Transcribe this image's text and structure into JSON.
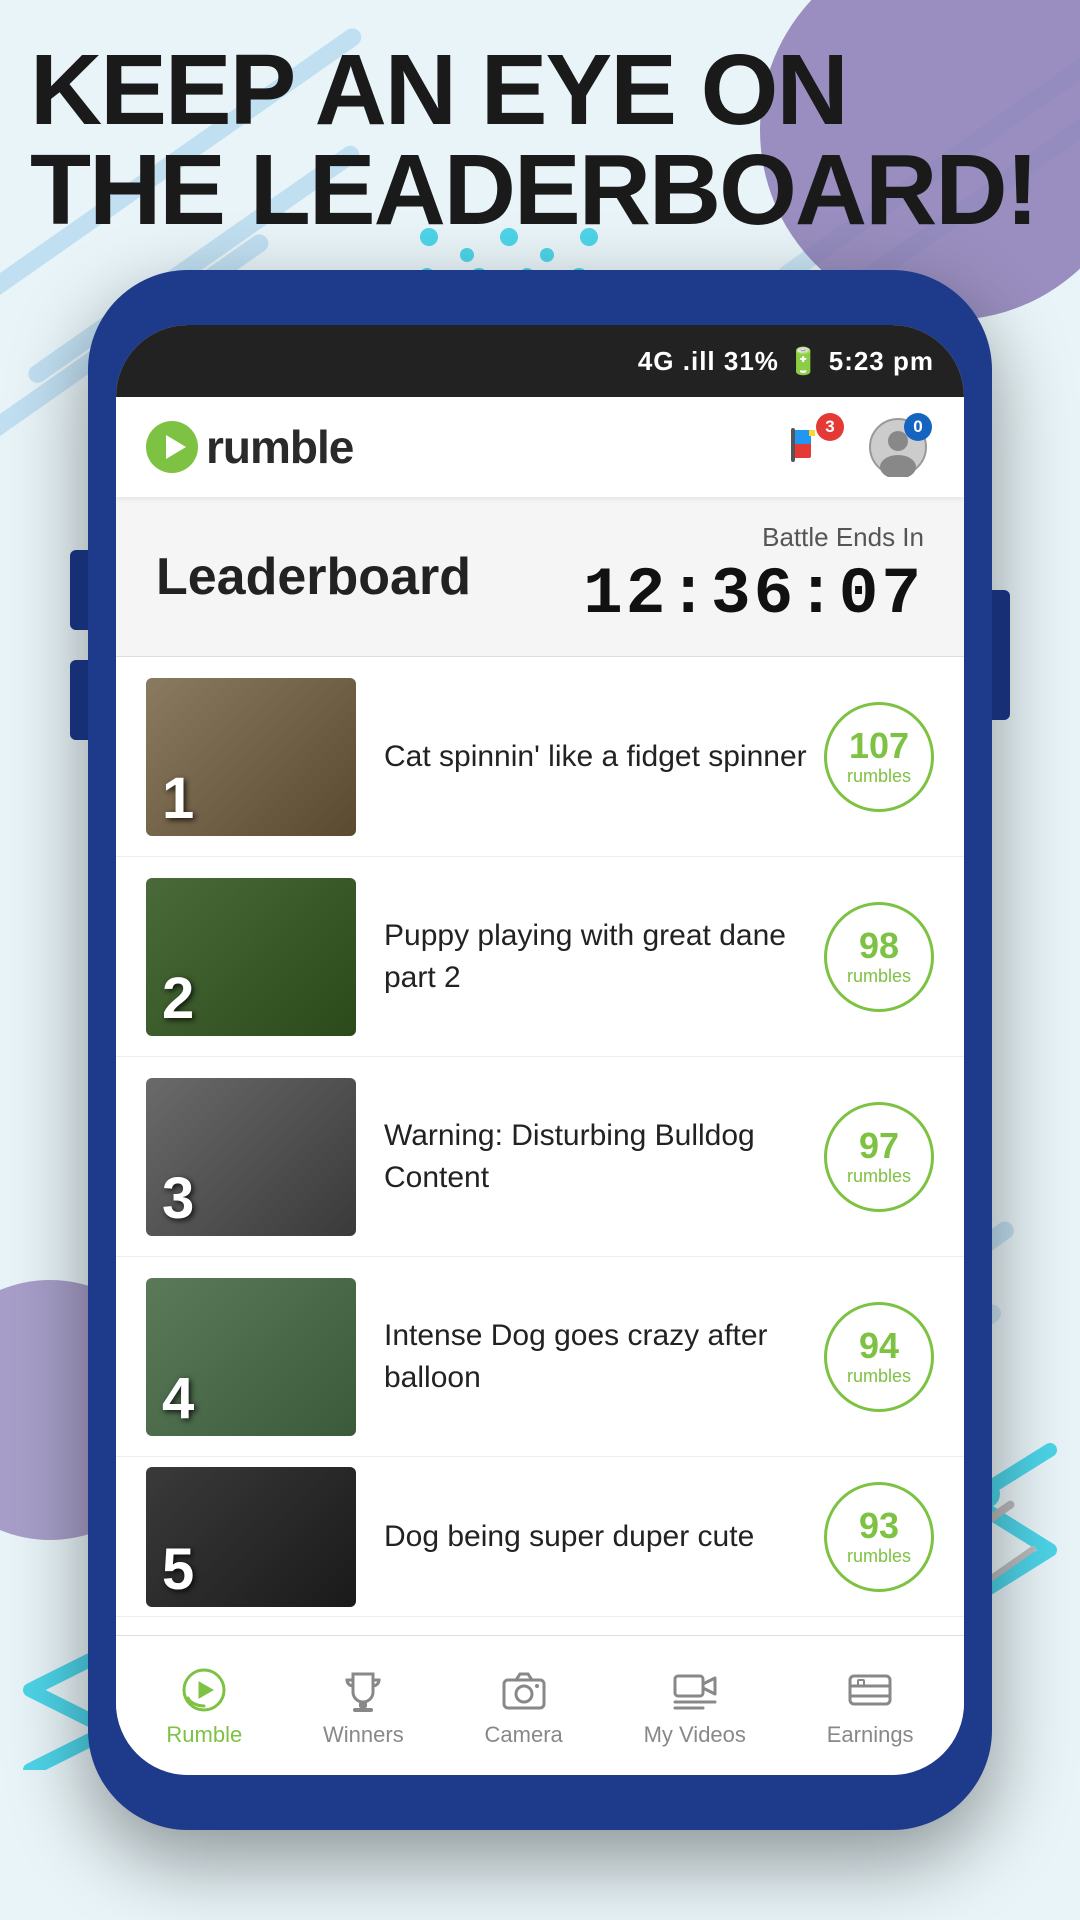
{
  "background": {
    "headline_line1": "KEEP AN EYE ON",
    "headline_line2": "THE LEADERBOARD!"
  },
  "status_bar": {
    "signal": "4G",
    "bars": "▌▌▌",
    "battery": "31%",
    "time": "5:23 pm",
    "full": "4G  .ill  31%  🔋  5:23 pm"
  },
  "app_header": {
    "logo_text": "rumble",
    "notification_badge": "3",
    "profile_badge": "0"
  },
  "leaderboard": {
    "title": "Leaderboard",
    "battle_ends_label": "Battle Ends In",
    "timer": "12:36:07"
  },
  "videos": [
    {
      "rank": "1",
      "title": "Cat spinnin' like a fidget spinner",
      "rumbles": "107",
      "rumbles_label": "rumbles",
      "thumb_class": "thumb-bg-1"
    },
    {
      "rank": "2",
      "title": "Puppy playing with great dane part 2",
      "rumbles": "98",
      "rumbles_label": "rumbles",
      "thumb_class": "thumb-bg-2"
    },
    {
      "rank": "3",
      "title": "Warning: Disturbing Bulldog Content",
      "rumbles": "97",
      "rumbles_label": "rumbles",
      "thumb_class": "thumb-bg-3"
    },
    {
      "rank": "4",
      "title": "Intense Dog goes crazy after balloon",
      "rumbles": "94",
      "rumbles_label": "rumbles",
      "thumb_class": "thumb-bg-4"
    },
    {
      "rank": "5",
      "title": "Dog being super duper cute",
      "rumbles": "93",
      "rumbles_label": "rumbles",
      "thumb_class": "thumb-bg-5"
    }
  ],
  "bottom_nav": [
    {
      "id": "rumble",
      "label": "Rumble",
      "active": true
    },
    {
      "id": "winners",
      "label": "Winners",
      "active": false
    },
    {
      "id": "camera",
      "label": "Camera",
      "active": false
    },
    {
      "id": "my-videos",
      "label": "My Videos",
      "active": false
    },
    {
      "id": "earnings",
      "label": "Earnings",
      "active": false
    }
  ],
  "colors": {
    "green": "#7dc242",
    "navy": "#1e3a8a",
    "purple": "#8b7bb5",
    "cyan": "#4dd4e8"
  }
}
